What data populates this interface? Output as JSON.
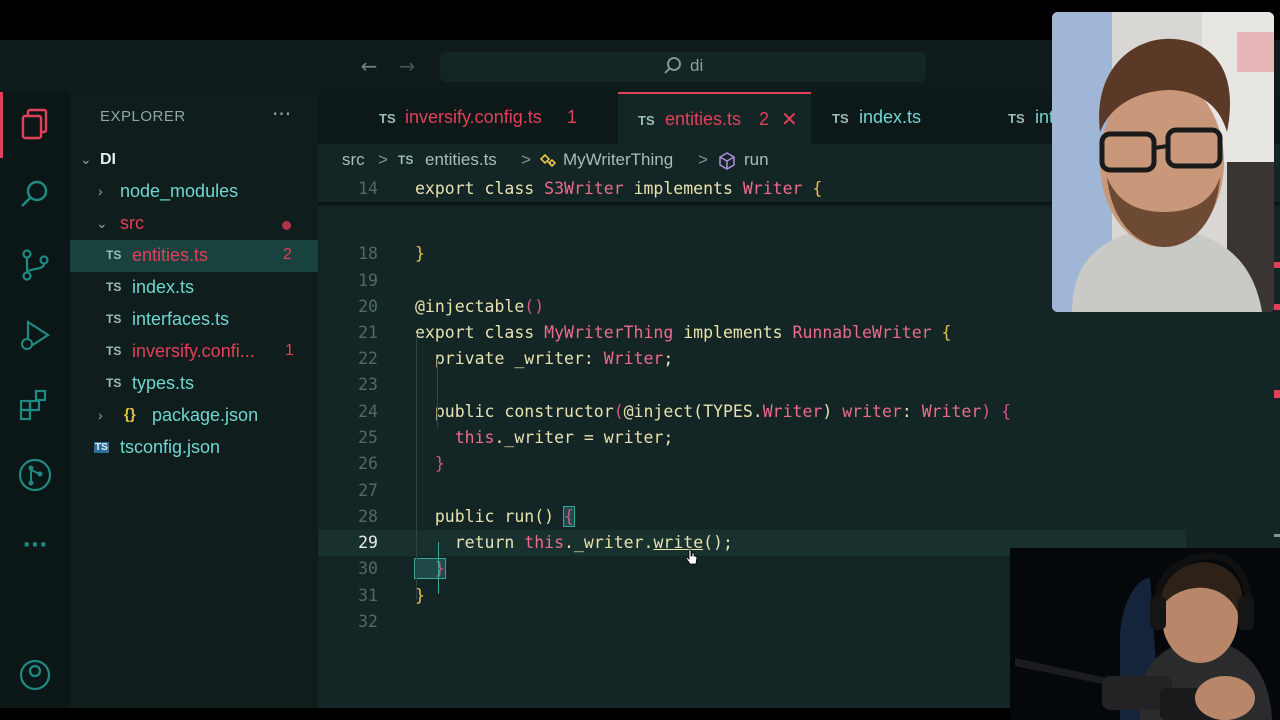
{
  "titlebar": {
    "back_icon": "arrow-left-icon",
    "forward_icon": "arrow-right-icon",
    "command_center_text": "di"
  },
  "activity_bar": {
    "items": [
      "files-icon",
      "search-icon",
      "source-control-icon",
      "run-debug-icon",
      "extensions-icon",
      "git-graph-icon",
      "more-icon",
      "account-icon"
    ]
  },
  "sidebar": {
    "header": "EXPLORER",
    "more": "···",
    "root": "DI",
    "items": [
      {
        "label": "node_modules"
      },
      {
        "label": "src"
      },
      {
        "badge": "TS",
        "label": "entities.ts",
        "count": "2"
      },
      {
        "badge": "TS",
        "label": "index.ts"
      },
      {
        "badge": "TS",
        "label": "interfaces.ts"
      },
      {
        "badge": "TS",
        "label": "inversify.confi...",
        "count": "1"
      },
      {
        "badge": "TS",
        "label": "types.ts"
      },
      {
        "badge": "{}",
        "label": "package.json"
      },
      {
        "badge": "TS",
        "label": "tsconfig.json"
      }
    ]
  },
  "tabs": [
    {
      "badge": "TS",
      "label": "inversify.config.ts",
      "count": "1"
    },
    {
      "badge": "TS",
      "label": "entities.ts",
      "count": "2",
      "close": "✕"
    },
    {
      "badge": "TS",
      "label": "index.ts"
    },
    {
      "badge": "TS",
      "label": "int"
    }
  ],
  "breadcrumb": {
    "folder": "src",
    "file_badge": "TS",
    "file": "entities.ts",
    "class": "MyWriterThing",
    "method": "run",
    "separator": ">"
  },
  "editor": {
    "current_line": "29",
    "lines": [
      {
        "n": "14",
        "tokens": [
          [
            "k",
            "export "
          ],
          [
            "k",
            "class "
          ],
          [
            "cl",
            "S3Writer "
          ],
          [
            "k",
            "implements "
          ],
          [
            "cl",
            "Writer "
          ],
          [
            "br",
            "{"
          ]
        ]
      },
      {
        "n": "18",
        "tokens": [
          [
            "br",
            "}"
          ]
        ]
      },
      {
        "n": "19",
        "tokens": []
      },
      {
        "n": "20",
        "tokens": [
          [
            "k",
            "@injectable"
          ],
          [
            "brp",
            "()"
          ]
        ]
      },
      {
        "n": "21",
        "tokens": [
          [
            "k",
            "export "
          ],
          [
            "k",
            "class "
          ],
          [
            "cl",
            "MyWriterThing "
          ],
          [
            "k",
            "implements "
          ],
          [
            "cl",
            "RunnableWriter "
          ],
          [
            "br",
            "{"
          ]
        ]
      },
      {
        "n": "22",
        "tokens": [
          [
            "k",
            "  private "
          ],
          [
            "pr",
            "_writer"
          ],
          [
            "p",
            ": "
          ],
          [
            "cl",
            "Writer"
          ],
          [
            "p",
            ";"
          ]
        ]
      },
      {
        "n": "23",
        "tokens": []
      },
      {
        "n": "24",
        "tokens": [
          [
            "k",
            "  public "
          ],
          [
            "fn",
            "constructor"
          ],
          [
            "brp",
            "("
          ],
          [
            "k",
            "@inject"
          ],
          [
            "p",
            "("
          ],
          [
            "pr",
            "TYPES."
          ],
          [
            "cl",
            "Writer"
          ],
          [
            "p",
            ") "
          ],
          [
            "cl",
            "writer"
          ],
          [
            "p",
            ": "
          ],
          [
            "cl",
            "Writer"
          ],
          [
            "brp",
            ") "
          ],
          [
            "brp",
            "{"
          ]
        ]
      },
      {
        "n": "25",
        "tokens": [
          [
            "th",
            "    this"
          ],
          [
            "p",
            "."
          ],
          [
            "pr",
            "_writer "
          ],
          [
            "p",
            "= "
          ],
          [
            "pr",
            "writer"
          ],
          [
            "p",
            ";"
          ]
        ]
      },
      {
        "n": "26",
        "tokens": [
          [
            "brp",
            "  }"
          ]
        ]
      },
      {
        "n": "27",
        "tokens": []
      },
      {
        "n": "28",
        "tokens": [
          [
            "k",
            "  public "
          ],
          [
            "fn",
            "run"
          ],
          [
            "p",
            "() "
          ],
          [
            "brhl",
            "{"
          ]
        ]
      },
      {
        "n": "29",
        "tokens": [
          [
            "k",
            "    return "
          ],
          [
            "th",
            "this"
          ],
          [
            "p",
            "."
          ],
          [
            "pr",
            "_writer"
          ],
          [
            "p",
            "."
          ],
          [
            "fn",
            "write"
          ],
          [
            "p",
            "();"
          ]
        ]
      },
      {
        "n": "30",
        "tokens": [
          [
            "brhl",
            "  }"
          ]
        ]
      },
      {
        "n": "31",
        "tokens": [
          [
            "br",
            "}"
          ]
        ]
      },
      {
        "n": "32",
        "tokens": []
      }
    ]
  },
  "colors": {
    "accent": "#e2405a",
    "editor_bg": "#132524",
    "sidebar_bg": "#0f1d1c",
    "teal_text": "#6fd6d0"
  }
}
